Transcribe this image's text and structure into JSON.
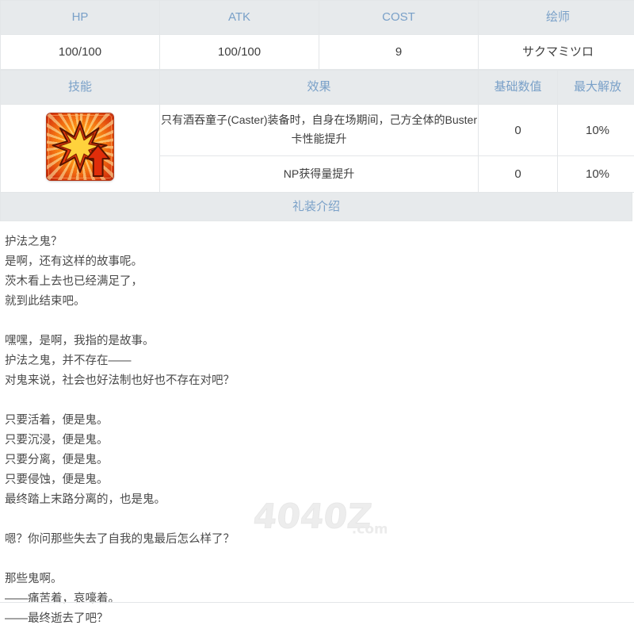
{
  "stats_table": {
    "headers": [
      "HP",
      "ATK",
      "COST",
      "绘师"
    ],
    "values": [
      "100/100",
      "100/100",
      "9",
      "サクマミツロ"
    ]
  },
  "skill_table": {
    "headers": {
      "skill": "技能",
      "effect": "效果",
      "base": "基础数值",
      "max": "最大解放"
    },
    "icon_name": "buster-up-icon",
    "rows": [
      {
        "effect": "只有酒吞童子(Caster)装备时，自身在场期间，己方全体的Buster卡性能提升",
        "base": "0",
        "max": "10%"
      },
      {
        "effect": "NP获得量提升",
        "base": "0",
        "max": "10%"
      }
    ]
  },
  "intro": {
    "band_title": "礼装介绍",
    "lines": [
      "护法之鬼？",
      "是啊，还有这样的故事呢。",
      "茨木看上去也已经满足了，",
      "就到此结束吧。",
      "",
      "嘿嘿，是啊，我指的是故事。",
      "护法之鬼，并不存在——",
      "对鬼来说，社会也好法制也好也不存在对吧？",
      "",
      "只要活着，便是鬼。",
      "只要沉浸，便是鬼。",
      "只要分离，便是鬼。",
      "只要侵蚀，便是鬼。",
      "最终踏上末路分离的，也是鬼。",
      "",
      "嗯？你问那些失去了自我的鬼最后怎么样了？",
      "",
      "那些鬼啊。",
      "——痛苦着，哀嚎着。",
      "——最终逝去了吧？"
    ]
  },
  "watermark": {
    "text": "4040Z",
    "suffix": ".com"
  },
  "colors": {
    "header_text": "#79a0c8",
    "header_bg": "#e7eaec",
    "body_text": "#3e3e3e",
    "border": "#e3e6e8",
    "icon_accent": "#ff7a10"
  }
}
